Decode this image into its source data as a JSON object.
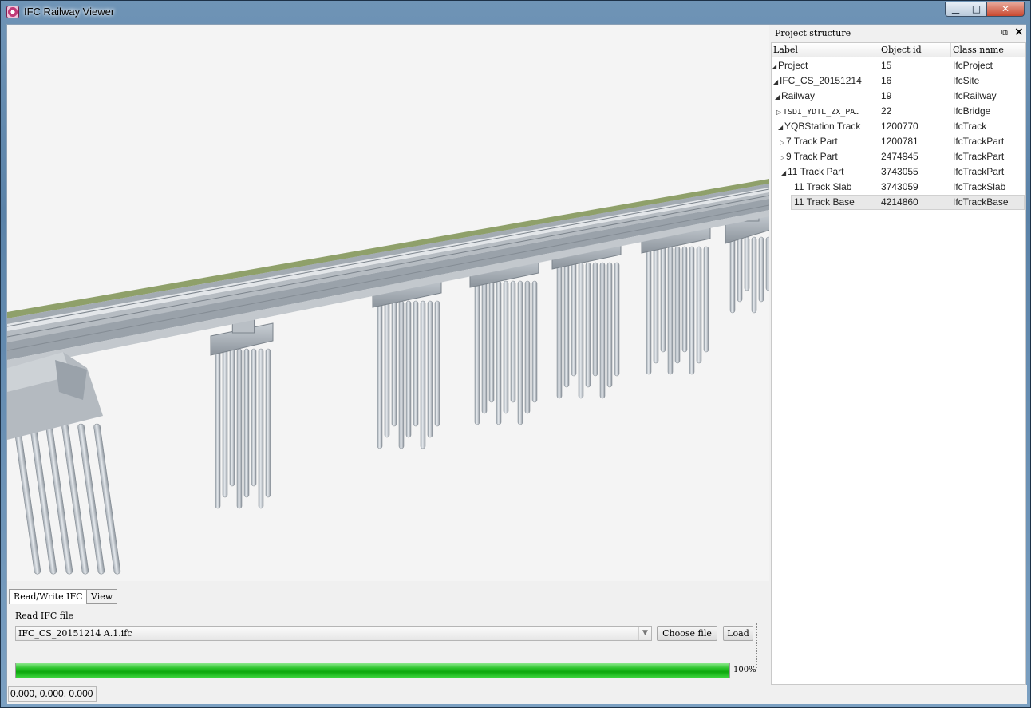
{
  "window": {
    "title": "IFC Railway Viewer",
    "min_label": "▁",
    "max_label": "□",
    "close_label": "✕"
  },
  "tabs": [
    {
      "label": "Read/Write IFC"
    },
    {
      "label": "View"
    }
  ],
  "read": {
    "label": "Read IFC file",
    "file_value": "IFC_CS_20151214 A.1.ifc",
    "choose_label": "Choose file",
    "load_label": "Load"
  },
  "progress": {
    "value": 1.0,
    "text": "100%"
  },
  "status": {
    "coords": "0.000, 0.000, 0.000"
  },
  "dock": {
    "title": "Project structure",
    "float_icon": "restore-icon",
    "close_icon": "close-icon",
    "columns": [
      "Label",
      "Object id",
      "Class name"
    ],
    "rows": [
      {
        "twisty": "◢",
        "label": "Project",
        "oid": "15",
        "cls": "IfcProject"
      },
      {
        "twisty": "◢",
        "label": "IFC_CS_20151214",
        "oid": "16",
        "cls": "IfcSite"
      },
      {
        "twisty": "◢",
        "label": "Railway",
        "oid": "19",
        "cls": "IfcRailway"
      },
      {
        "twisty": "▷",
        "label": "TSDI_YDTL_ZX_PA…",
        "oid": "22",
        "cls": "IfcBridge"
      },
      {
        "twisty": "◢",
        "label": "YQBStation Track",
        "oid": "1200770",
        "cls": "IfcTrack"
      },
      {
        "twisty": "▷",
        "label": "7 Track Part",
        "oid": "1200781",
        "cls": "IfcTrackPart"
      },
      {
        "twisty": "▷",
        "label": "9 Track Part",
        "oid": "2474945",
        "cls": "IfcTrackPart"
      },
      {
        "twisty": "◢",
        "label": "11 Track Part",
        "oid": "3743055",
        "cls": "IfcTrackPart"
      },
      {
        "twisty": "",
        "label": "11 Track Slab",
        "oid": "3743059",
        "cls": "IfcTrackSlab"
      },
      {
        "twisty": "",
        "label": "11 Track Base",
        "oid": "4214860",
        "cls": "IfcTrackBase"
      }
    ]
  },
  "colors": {
    "progress": "#1cb81c",
    "selection": "#e8e8e8",
    "deck_top": "#8fa06a"
  }
}
